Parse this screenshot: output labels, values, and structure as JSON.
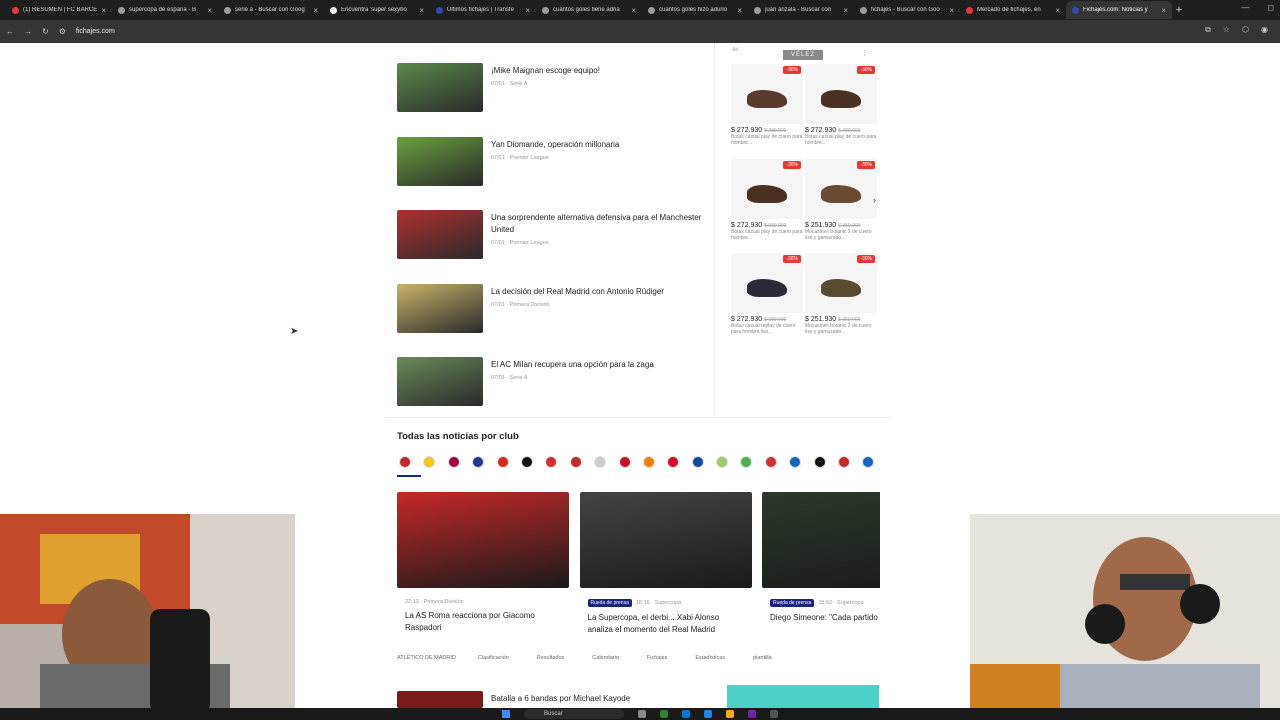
{
  "tabs": [
    {
      "label": "(1) RESUMEN | FC BARCE",
      "color": "#e53935"
    },
    {
      "label": "supercopa de españa - B",
      "color": "#9e9e9e"
    },
    {
      "label": "serie a - Buscar con Goog",
      "color": "#9e9e9e"
    },
    {
      "label": "Encuentra 'super sexybo",
      "color": "#eee"
    },
    {
      "label": "Últimos fichajes | Transfe",
      "color": "#3949ab"
    },
    {
      "label": "cuantos goles tiene adria",
      "color": "#9e9e9e"
    },
    {
      "label": "cuantos goles hizo adurio",
      "color": "#9e9e9e"
    },
    {
      "label": "juan arizala - Buscar con",
      "color": "#9e9e9e"
    },
    {
      "label": "fichajes - Buscar con Goo",
      "color": "#9e9e9e"
    },
    {
      "label": "Mercado de fichajes, en",
      "color": "#e53935"
    },
    {
      "label": "Fichajes.com: Noticias y",
      "color": "#3949ab",
      "active": true
    }
  ],
  "address": {
    "url": "fichajes.com"
  },
  "news": [
    {
      "title": "¡Mike Maignan escoge equipo!",
      "meta": "07/01 · Serie A",
      "color": "#5b8a4a"
    },
    {
      "title": "Yan Diomande, operación millonaria",
      "meta": "07/01 · Premier League",
      "color": "#6ba03e"
    },
    {
      "title": "Una sorprendente alternativa defensiva para el Manchester United",
      "meta": "07/01 · Premier League",
      "color": "#b03030"
    },
    {
      "title": "La decisión del Real Madrid con Antonio Rüdiger",
      "meta": "07/01 · Primera División",
      "color": "#c9b36a"
    },
    {
      "title": "El AC Milan recupera una opción para la zaga",
      "meta": "07/01 · Serie A",
      "color": "#6a8a5a"
    }
  ],
  "ad": {
    "label": "Ad",
    "brand": "VÉLEZ",
    "products": [
      {
        "discount": "-30%",
        "price": "$ 272.930",
        "old": "$ 389.900",
        "desc": "Botas casual play de cuero para hombre...",
        "shoe": "#5a3a2a"
      },
      {
        "discount": "-30%",
        "price": "$ 272.930",
        "old": "$ 389.900",
        "desc": "Botas casual play de cuero para hombre...",
        "shoe": "#4a3020"
      },
      {
        "discount": "-30%",
        "price": "$ 272.930",
        "old": "$ 389.900",
        "desc": "Botas casual play de cuero para hombre...",
        "shoe": "#4a3020"
      },
      {
        "discount": "-30%",
        "price": "$ 251.930",
        "old": "$ 359.900",
        "desc": "Mocasines botanic 2 de cuero liso y gamuzado...",
        "shoe": "#6a4a30"
      },
      {
        "discount": "-30%",
        "price": "$ 272.930",
        "old": "$ 389.900",
        "desc": "Botas casual replay de cuero para hombre liso...",
        "shoe": "#2a2a3a"
      },
      {
        "discount": "-30%",
        "price": "$ 251.930",
        "old": "$ 359.900",
        "desc": "Mocasines botanic 2 de cuero liso y gamuzado...",
        "shoe": "#5a4a30"
      }
    ]
  },
  "clubs_title": "Todas las noticias por club",
  "clubs": [
    "#c62828",
    "#f5c518",
    "#a50044",
    "#1e3a8a",
    "#da291c",
    "#111111",
    "#d32f2f",
    "#c62828",
    "#cccccc",
    "#c8102e",
    "#f57c00",
    "#dc052d",
    "#0d47a1",
    "#9ccc65",
    "#4caf50",
    "#d32f2f",
    "#1565c0",
    "#111111",
    "#c62828",
    "#1565c0"
  ],
  "cards": [
    {
      "meta": "22:13 · Primera División",
      "badge": "",
      "title": "La AS Roma reacciona por Giacomo Raspadori",
      "color": "#c62828"
    },
    {
      "meta": "18:16 · Supercopa",
      "badge": "Rueda de prensa",
      "title": "La Supercopa, el derbi... Xabi Alonso analiza el momento del Real Madrid",
      "color": "#444"
    },
    {
      "meta": "15:52 · Supercopa",
      "badge": "Rueda de prensa",
      "title": "Diego Simeone: \"Cada partido es diferente\"",
      "color": "#2a3a2a"
    }
  ],
  "tags": [
    "ATLÉTICO DE MADRID",
    "Clasificación",
    "Resultados",
    "Calendario",
    "Fichajes",
    "Estadísticas",
    "plantilla"
  ],
  "bottom_news": "Batalla a 6 bandas por Michael Kayode",
  "taskbar": {
    "search": "Buscar"
  }
}
